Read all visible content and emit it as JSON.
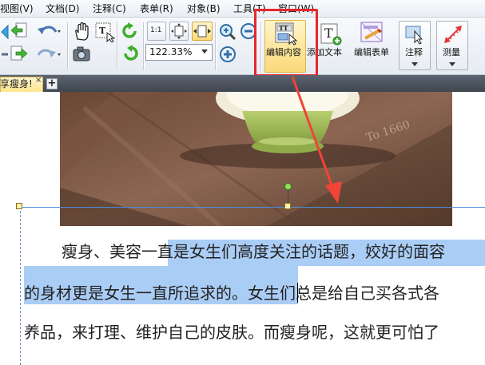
{
  "menu": {
    "items": [
      "视图(V)",
      "文档(D)",
      "注释(C)",
      "表单(R)",
      "对象(B)",
      "工具(T)",
      "窗口(W)"
    ]
  },
  "toolbar": {
    "zoom_value": "122.33%",
    "edit_content_label": "编辑内容",
    "add_text_label": "添加文本",
    "edit_form_label": "编辑表单",
    "annotate_label": "注释",
    "measure_label": "测量",
    "actual_size_label": "1:1"
  },
  "tabs": {
    "active_label": "享瘦身!",
    "close_glyph": "×",
    "new_tab_glyph": "+"
  },
  "photo": {
    "text": "To 1660"
  },
  "document": {
    "line1_before": "瘦身、美容",
    "line1_selected": "一直是女生们高度关注的话题，姣好的面容",
    "line2_selected": "的身材更是女生一直所追求的。女",
    "line2_after": "生们总是给自己买各式各",
    "line3": "养品，来打理、维护自己的皮肤。而瘦身呢，这就更可怕了"
  },
  "colors": {
    "selection": "#aacdf6",
    "highlight_frame": "#e8262b",
    "active_button": "#fbd97a",
    "annotation_arrow": "#f04438"
  }
}
